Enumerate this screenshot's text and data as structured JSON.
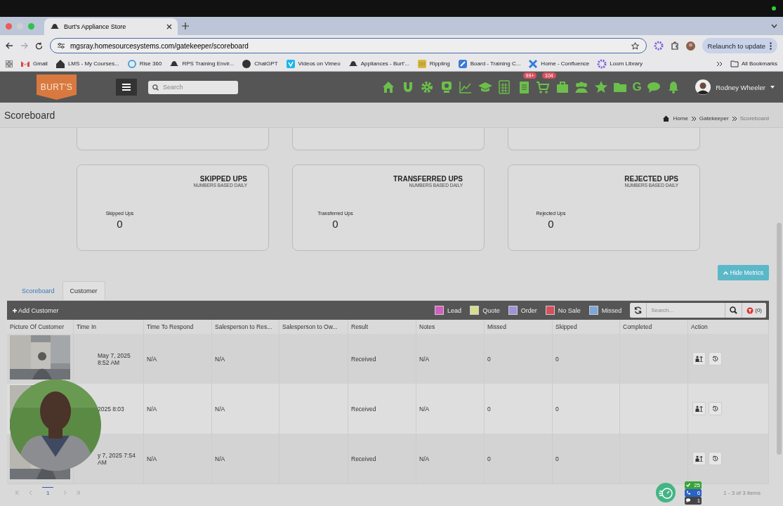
{
  "browser": {
    "tab_title": "Burt's Appliance Store",
    "url": "mgsray.homesourcesystems.com/gatekeeper/scoreboard",
    "relaunch": "Relaunch to update",
    "bookmarks": [
      {
        "label": "Gmail",
        "kind": "mail"
      },
      {
        "label": "LMS - My Courses...",
        "kind": "house"
      },
      {
        "label": "Rise 360",
        "kind": "ring"
      },
      {
        "label": "RPS Training Envir...",
        "kind": "hat"
      },
      {
        "label": "ChatGPT",
        "kind": "dot"
      },
      {
        "label": "Videos on Vimeo",
        "kind": "vbox"
      },
      {
        "label": "Appliances - Burt'...",
        "kind": "hat"
      },
      {
        "label": "Rippling",
        "kind": "ybox"
      },
      {
        "label": "Board - Training C...",
        "kind": "bbox"
      },
      {
        "label": "Home - Confluence",
        "kind": "cross"
      },
      {
        "label": "Loom Library",
        "kind": "burst"
      }
    ],
    "all_bookmarks": "All Bookmarks"
  },
  "app": {
    "logo": "BURT'S",
    "search_placeholder": "Search",
    "user_name": "Rodney Wheeler",
    "nav": [
      {
        "kind": "home"
      },
      {
        "kind": "magnet"
      },
      {
        "kind": "gear"
      },
      {
        "kind": "webcam"
      },
      {
        "kind": "chart"
      },
      {
        "kind": "cap"
      },
      {
        "kind": "calculator"
      },
      {
        "kind": "notebook",
        "badge": "99+"
      },
      {
        "kind": "cart",
        "badge": "104"
      },
      {
        "kind": "briefcase"
      },
      {
        "kind": "group"
      },
      {
        "kind": "star"
      },
      {
        "kind": "folder"
      },
      {
        "kind": "letter",
        "text": "G"
      },
      {
        "kind": "chat"
      },
      {
        "kind": "bell"
      }
    ]
  },
  "page": {
    "title": "Scoreboard",
    "breadcrumb": [
      {
        "label": "Home",
        "current": false
      },
      {
        "label": "Gatekeeper",
        "current": false
      },
      {
        "label": "Scoreboard",
        "current": true
      }
    ]
  },
  "metrics": [
    {
      "title": "SKIPPED UPS",
      "subtitle": "NUMBERS BASED DAILY",
      "label": "Skipped Ups",
      "value": "0"
    },
    {
      "title": "TRANSFERRED UPS",
      "subtitle": "NUMBERS BASED DAILY",
      "label": "Transferred Ups",
      "value": "0"
    },
    {
      "title": "REJECTED UPS",
      "subtitle": "NUMBERS BASED DAILY",
      "label": "Rejected Ups",
      "value": "0"
    }
  ],
  "hide_metrics": "Hide Metrics",
  "tabs": [
    {
      "label": "Scoreboard",
      "selected": false
    },
    {
      "label": "Customer",
      "selected": true
    }
  ],
  "toolbar": {
    "add": "Add Customer",
    "legend": [
      {
        "label": "Lead",
        "color": "#d35fbd"
      },
      {
        "label": "Quote",
        "color": "#d6dc90"
      },
      {
        "label": "Order",
        "color": "#9d93d8"
      },
      {
        "label": "No Sale",
        "color": "#d4505e"
      },
      {
        "label": "Missed",
        "color": "#7ea7d9"
      }
    ],
    "search_placeholder": "Search...",
    "filter_count": "(0)"
  },
  "columns": [
    "Picture Of Customer",
    "Time In",
    "Time To Respond",
    "Salesperson to Res...",
    "Salesperson to Ow...",
    "Result",
    "Notes",
    "Missed",
    "Skipped",
    "Completed",
    "Action"
  ],
  "rows": [
    {
      "time_in": "May 7, 2025 8:52 AM",
      "time_to_respond": "N/A",
      "salesperson_respond": "N/A",
      "result": "Received",
      "notes": "N/A",
      "missed": "0",
      "skipped": "0"
    },
    {
      "time_in": "2025 8:03",
      "time_to_respond": "N/A",
      "salesperson_respond": "N/A",
      "result": "Received",
      "notes": "N/A",
      "missed": "0",
      "skipped": "0"
    },
    {
      "time_in": "y 7, 2025 7:54 AM",
      "time_to_respond": "N/A",
      "salesperson_respond": "N/A",
      "result": "Received",
      "notes": "N/A",
      "missed": "0",
      "skipped": "0"
    }
  ],
  "pager": {
    "page": "1",
    "summary": "1 - 3 of 3 items"
  },
  "counters": [
    {
      "kind": "done",
      "value": "25",
      "color": "#3aa33a"
    },
    {
      "kind": "call",
      "value": "6",
      "color": "#2b62c4"
    },
    {
      "kind": "chat",
      "value": "1",
      "color": "#444444"
    }
  ]
}
